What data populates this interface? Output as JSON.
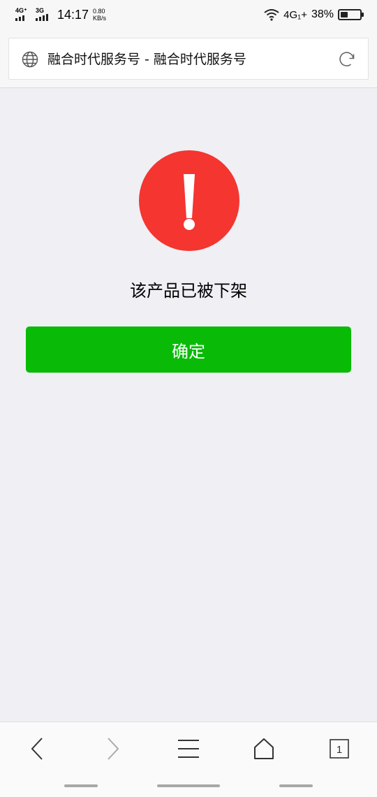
{
  "status_bar": {
    "sim1_label": "4G⁺",
    "sim2_label": "3G",
    "time": "14:17",
    "speed_value": "0.80",
    "speed_unit": "KB/s",
    "network_right": "4G₁+",
    "battery_percent": "38%",
    "battery_level": 0.38
  },
  "header": {
    "title": "融合时代服务号 - 融合时代服务号"
  },
  "main": {
    "message": "该产品已被下架",
    "confirm_label": "确定"
  },
  "bottom_nav": {
    "tab_count": "1"
  },
  "colors": {
    "alert_red": "#f43530",
    "confirm_green": "#09bb07",
    "page_bg": "#efeff4"
  },
  "icons": [
    "globe-icon",
    "refresh-icon",
    "alert-icon",
    "back-icon",
    "forward-icon",
    "menu-icon",
    "home-icon",
    "tabs-icon"
  ]
}
